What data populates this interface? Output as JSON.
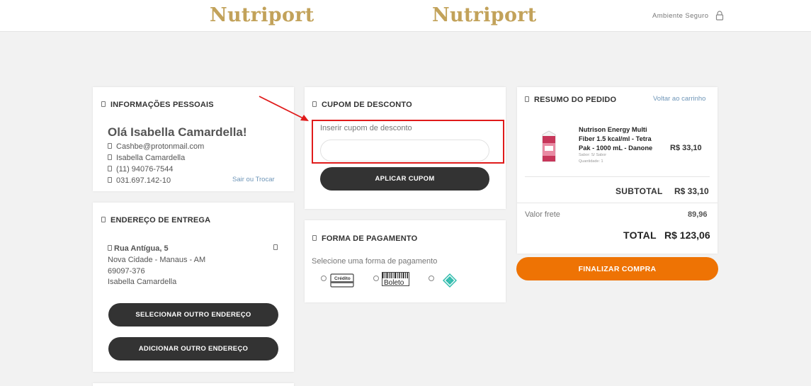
{
  "header": {
    "logo_text_1": "Nutriport",
    "logo_text_2": "Nutriport",
    "secure_label": "Ambiente Seguro"
  },
  "personal": {
    "title": "INFORMAÇÕES PESSOAIS",
    "greeting": "Olá Isabella Camardella!",
    "email": "Cashbe@protonmail.com",
    "name": "Isabella Camardella",
    "phone": "(11) 94076-7544",
    "document": "031.697.142-10",
    "switch_link": "Sair ou Trocar"
  },
  "address": {
    "title": "ENDEREÇO DE ENTREGA",
    "street": "Rua Antígua, 5",
    "city": "Nova Cidade - Manaus - AM",
    "zip": "69097-376",
    "recipient": "Isabella Camardella",
    "select_button": "SELECIONAR OUTRO ENDEREÇO",
    "add_button": "ADICIONAR OUTRO ENDEREÇO"
  },
  "coupon": {
    "title": "CUPOM DE DESCONTO",
    "label": "Inserir cupom de desconto",
    "input_value": "",
    "apply_button": "APLICAR CUPOM"
  },
  "payment": {
    "title": "FORMA DE PAGAMENTO",
    "label": "Selecione uma forma de pagamento",
    "options": [
      {
        "name": "credit-card",
        "text": "Crédito"
      },
      {
        "name": "boleto",
        "text": "Boleto"
      },
      {
        "name": "pix",
        "text": ""
      }
    ]
  },
  "summary": {
    "title": "RESUMO DO PEDIDO",
    "back_link": "Voltar ao carrinho",
    "product_name": "Nutrison Energy Multi Fiber 1.5 kcal/ml - Tetra Pak - 1000 mL - Danone",
    "product_flavor": "Sabor: S/ Sabor",
    "product_qty": "Quantidade: 1",
    "product_price": "R$ 33,10",
    "subtotal_label": "SUBTOTAL",
    "subtotal_value": "R$ 33,10",
    "shipping_label": "Valor frete",
    "shipping_value": "89,96",
    "total_label": "TOTAL",
    "total_value": "R$ 123,06",
    "finish_button": "FINALIZAR COMPRA"
  },
  "colors": {
    "accent": "#ee7304",
    "dark_button": "#333333",
    "highlight": "#e01b1b",
    "logo": "#c2a25a"
  }
}
